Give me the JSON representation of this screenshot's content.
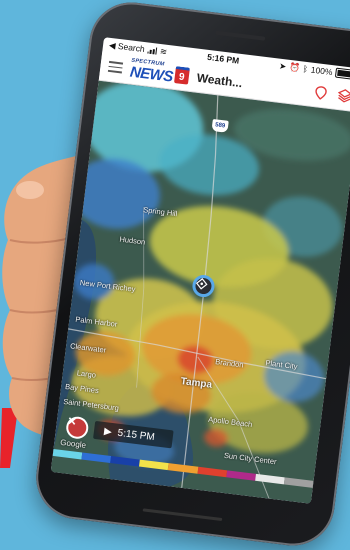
{
  "status_bar": {
    "back_label": "Search",
    "time": "5:16 PM",
    "battery_percent": "100%"
  },
  "header": {
    "logo_small": "SPECTRUM",
    "logo_big": "NEWS",
    "logo_badge": "9",
    "title": "Weath..."
  },
  "map": {
    "labels": {
      "springhill": "Spring Hill",
      "hudson": "Hudson",
      "newport_richey": "New Port Richey",
      "palm_harbor": "Palm Harbor",
      "clearwater": "Clearwater",
      "largo": "Largo",
      "tampa": "Tampa",
      "brandon": "Brandon",
      "plant_city": "Plant City",
      "st_petersburg": "Saint Petersburg",
      "apollo_beach": "Apollo Beach",
      "bay_pines": "Bay Pines",
      "sun_city": "Sun City Center"
    },
    "interstate": "589",
    "time_display": "5:15 PM",
    "google": "Google"
  },
  "colors": {
    "background": "#5fb6dc",
    "app_blue": "#1d4fb8",
    "accent_red": "#d62c2c"
  },
  "legend_colors": [
    "#6ad4e8",
    "#2e6fd6",
    "#1840a8",
    "#f2e24a",
    "#f0a030",
    "#e0402e",
    "#b02a8a",
    "#e8e8e8",
    "#a0a0a0"
  ]
}
